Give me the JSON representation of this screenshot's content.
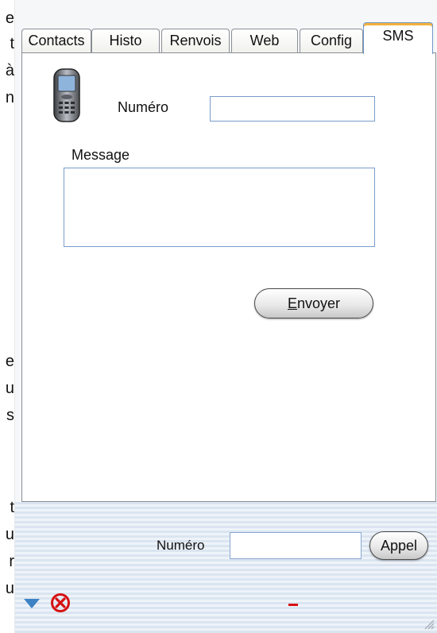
{
  "background_text": [
    "e",
    "t",
    "à",
    "n",
    "e",
    "u",
    "s",
    "t",
    "u",
    "r",
    "u"
  ],
  "tabs": [
    {
      "label": "Contacts"
    },
    {
      "label": "Histo"
    },
    {
      "label": "Renvois"
    },
    {
      "label": "Web"
    },
    {
      "label": "Config"
    },
    {
      "label": "SMS"
    }
  ],
  "active_tab": "SMS",
  "sms": {
    "numero_label": "Numéro",
    "numero_value": "",
    "message_label": "Message",
    "message_value": "",
    "send_button_rest": "nvoyer",
    "send_button_mnemonic": "E"
  },
  "footer": {
    "numero_label": "Numéro",
    "numero_value": "",
    "call_button": "Appel"
  },
  "colors": {
    "tab_active_accent": "#f3b23b",
    "status_red": "#d61010",
    "arrow_blue": "#3d82c4"
  },
  "icons": [
    "mobile-phone-icon",
    "triangle-down-icon",
    "close-circle-icon",
    "resize-grip-icon"
  ]
}
